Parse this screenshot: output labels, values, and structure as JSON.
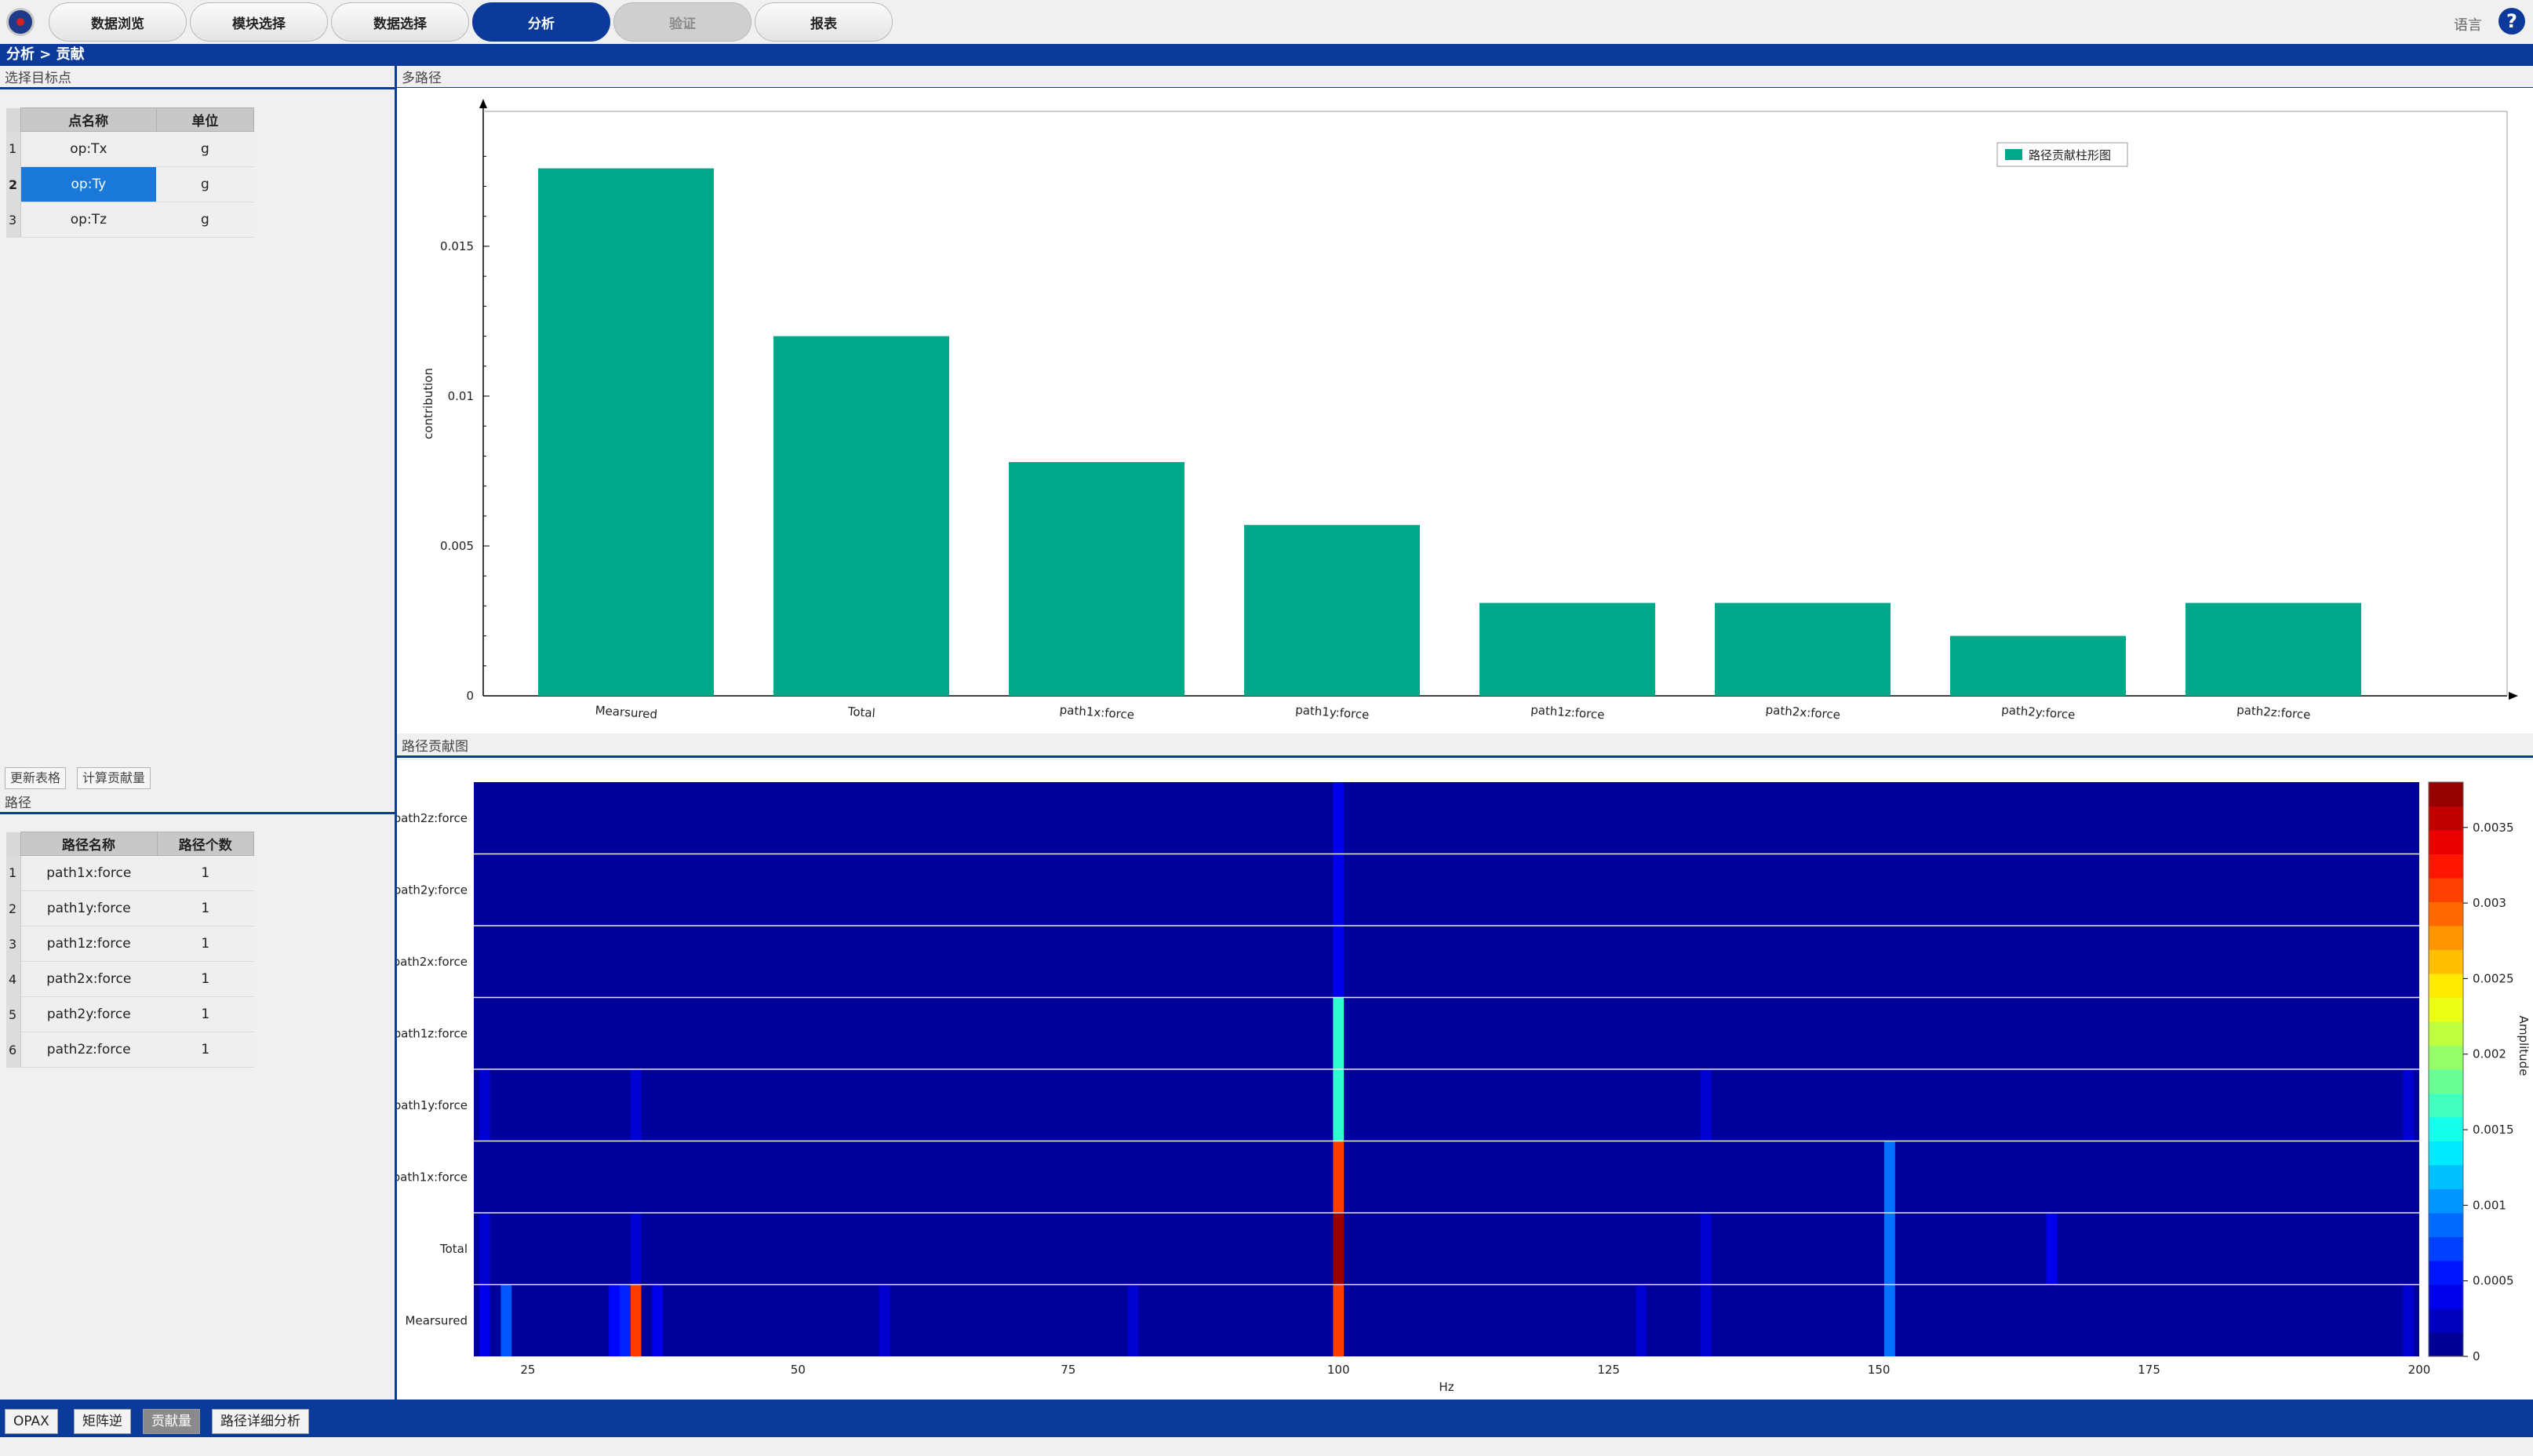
{
  "nav": {
    "tabs": [
      "数据浏览",
      "模块选择",
      "数据选择",
      "分析",
      "验证",
      "报表"
    ],
    "active_index": 3,
    "disabled_index": 4,
    "language_label": "语言",
    "help_glyph": "?"
  },
  "breadcrumb": "分析 > 贡献",
  "target_panel": {
    "title": "选择目标点",
    "headers": [
      "点名称",
      "单位"
    ],
    "rows": [
      {
        "idx": "1",
        "name": "op:Tx",
        "unit": "g"
      },
      {
        "idx": "2",
        "name": "op:Ty",
        "unit": "g"
      },
      {
        "idx": "3",
        "name": "op:Tz",
        "unit": "g"
      }
    ],
    "selected_index": 1
  },
  "actions": {
    "update_table": "更新表格",
    "compute": "计算贡献量"
  },
  "path_panel": {
    "title": "路径",
    "headers": [
      "路径名称",
      "路径个数"
    ],
    "rows": [
      {
        "idx": "1",
        "name": "path1x:force",
        "count": "1"
      },
      {
        "idx": "2",
        "name": "path1y:force",
        "count": "1"
      },
      {
        "idx": "3",
        "name": "path1z:force",
        "count": "1"
      },
      {
        "idx": "4",
        "name": "path2x:force",
        "count": "1"
      },
      {
        "idx": "5",
        "name": "path2y:force",
        "count": "1"
      },
      {
        "idx": "6",
        "name": "path2z:force",
        "count": "1"
      }
    ]
  },
  "chart_panel_title": "多路径",
  "heatmap_panel_title": "路径贡献图",
  "chart_data": [
    {
      "type": "bar",
      "categories": [
        "Mearsured",
        "Total",
        "path1x:force",
        "path1y:force",
        "path1z:force",
        "path2x:force",
        "path2y:force",
        "path2z:force"
      ],
      "series": [
        {
          "name": "路径贡献柱形图",
          "values": [
            0.0176,
            0.012,
            0.0078,
            0.0057,
            0.0031,
            0.0031,
            0.002,
            0.0031
          ]
        }
      ],
      "ylabel": "contribution",
      "xlabel": "",
      "yticks": [
        "0",
        "0.005",
        "0.01",
        "0.015"
      ],
      "ylim": [
        0,
        0.0195
      ],
      "color": "#00a88a",
      "legend": "top-right"
    },
    {
      "type": "heatmap",
      "rows": [
        "path2z:force",
        "path2y:force",
        "path2x:force",
        "path1z:force",
        "path1y:force",
        "path1x:force",
        "Total",
        "Mearsured"
      ],
      "x_range": [
        20,
        200
      ],
      "xticks": [
        "25",
        "50",
        "75",
        "100",
        "125",
        "150",
        "175",
        "200"
      ],
      "xlabel": "Hz",
      "colorbar_label": "Amplitude",
      "colorbar_ticks": [
        "0",
        "0.0005",
        "0.001",
        "0.0015",
        "0.002",
        "0.0025",
        "0.003",
        "0.0035"
      ],
      "zlim": [
        0,
        0.0038
      ],
      "background_value": 0.0001,
      "cells": [
        {
          "row": "path2z:force",
          "hz": 100,
          "v": 0.0004
        },
        {
          "row": "path2y:force",
          "hz": 100,
          "v": 0.0004
        },
        {
          "row": "path2x:force",
          "hz": 100,
          "v": 0.0004
        },
        {
          "row": "path1z:force",
          "hz": 100,
          "v": 0.0016
        },
        {
          "row": "path1y:force",
          "hz": 21,
          "v": 0.0003
        },
        {
          "row": "path1y:force",
          "hz": 35,
          "v": 0.0003
        },
        {
          "row": "path1y:force",
          "hz": 100,
          "v": 0.0016
        },
        {
          "row": "path1y:force",
          "hz": 134,
          "v": 0.0003
        },
        {
          "row": "path1y:force",
          "hz": 199,
          "v": 0.0003
        },
        {
          "row": "path1x:force",
          "hz": 100,
          "v": 0.0031
        },
        {
          "row": "path1x:force",
          "hz": 151,
          "v": 0.0009
        },
        {
          "row": "Total",
          "hz": 21,
          "v": 0.0003
        },
        {
          "row": "Total",
          "hz": 35,
          "v": 0.0003
        },
        {
          "row": "Total",
          "hz": 100,
          "v": 0.0037
        },
        {
          "row": "Total",
          "hz": 134,
          "v": 0.0003
        },
        {
          "row": "Total",
          "hz": 151,
          "v": 0.0009
        },
        {
          "row": "Total",
          "hz": 166,
          "v": 0.0004
        },
        {
          "row": "Mearsured",
          "hz": 21,
          "v": 0.0004
        },
        {
          "row": "Mearsured",
          "hz": 23,
          "v": 0.0008
        },
        {
          "row": "Mearsured",
          "hz": 33,
          "v": 0.0005
        },
        {
          "row": "Mearsured",
          "hz": 34,
          "v": 0.0006
        },
        {
          "row": "Mearsured",
          "hz": 35,
          "v": 0.0031
        },
        {
          "row": "Mearsured",
          "hz": 37,
          "v": 0.0004
        },
        {
          "row": "Mearsured",
          "hz": 58,
          "v": 0.0003
        },
        {
          "row": "Mearsured",
          "hz": 81,
          "v": 0.0003
        },
        {
          "row": "Mearsured",
          "hz": 100,
          "v": 0.0031
        },
        {
          "row": "Mearsured",
          "hz": 128,
          "v": 0.0003
        },
        {
          "row": "Mearsured",
          "hz": 134,
          "v": 0.0003
        },
        {
          "row": "Mearsured",
          "hz": 151,
          "v": 0.0009
        },
        {
          "row": "Mearsured",
          "hz": 199,
          "v": 0.0003
        }
      ]
    }
  ],
  "bottom_tabs": [
    "OPAX",
    "矩阵逆",
    "贡献量",
    "路径详细分析"
  ],
  "bottom_active_index": 2
}
